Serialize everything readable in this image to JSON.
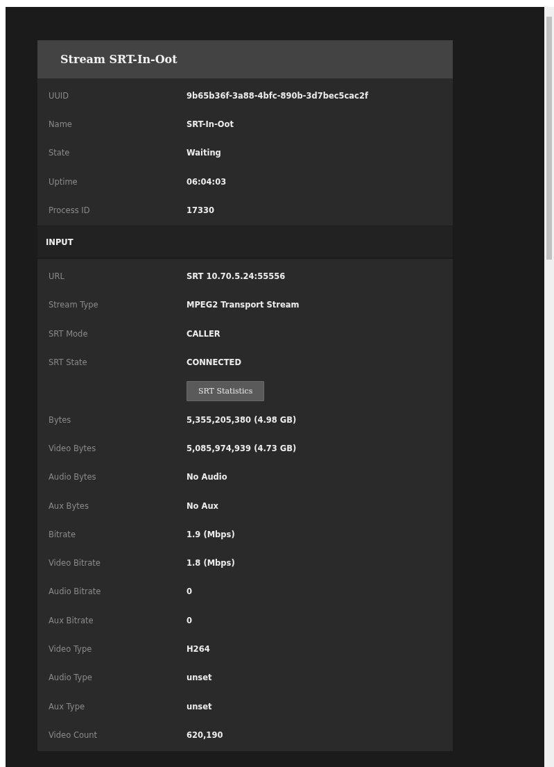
{
  "panel": {
    "title": "Stream SRT-In-Oot",
    "fields": [
      {
        "label": "UUID",
        "value": "9b65b36f-3a88-4bfc-890b-3d7bec5cac2f"
      },
      {
        "label": "Name",
        "value": "SRT-In-Oot"
      },
      {
        "label": "State",
        "value": "Waiting"
      },
      {
        "label": "Uptime",
        "value": "06:04:03"
      },
      {
        "label": "Process ID",
        "value": "17330"
      }
    ],
    "input": {
      "title": "INPUT",
      "rows": [
        {
          "kind": "field",
          "label": "URL",
          "value": "SRT 10.70.5.24:55556"
        },
        {
          "kind": "field",
          "label": "Stream Type",
          "value": "MPEG2 Transport Stream"
        },
        {
          "kind": "field",
          "label": "SRT Mode",
          "value": "CALLER"
        },
        {
          "kind": "field",
          "label": "SRT State",
          "value": "CONNECTED"
        },
        {
          "kind": "button",
          "value": "SRT Statistics"
        },
        {
          "kind": "field",
          "label": "Bytes",
          "value": "5,355,205,380 (4.98 GB)"
        },
        {
          "kind": "field",
          "label": "Video Bytes",
          "value": "5,085,974,939 (4.73 GB)"
        },
        {
          "kind": "field",
          "label": "Audio Bytes",
          "value": "No Audio"
        },
        {
          "kind": "field",
          "label": "Aux Bytes",
          "value": "No Aux"
        },
        {
          "kind": "field",
          "label": "Bitrate",
          "value": "1.9 (Mbps)"
        },
        {
          "kind": "field",
          "label": "Video Bitrate",
          "value": "1.8 (Mbps)"
        },
        {
          "kind": "field",
          "label": "Audio Bitrate",
          "value": "0"
        },
        {
          "kind": "field",
          "label": "Aux Bitrate",
          "value": "0"
        },
        {
          "kind": "field",
          "label": "Video Type",
          "value": "H264"
        },
        {
          "kind": "field",
          "label": "Audio Type",
          "value": "unset"
        },
        {
          "kind": "field",
          "label": "Aux Type",
          "value": "unset"
        },
        {
          "kind": "field",
          "label": "Video Count",
          "value": "620,190"
        }
      ]
    }
  }
}
